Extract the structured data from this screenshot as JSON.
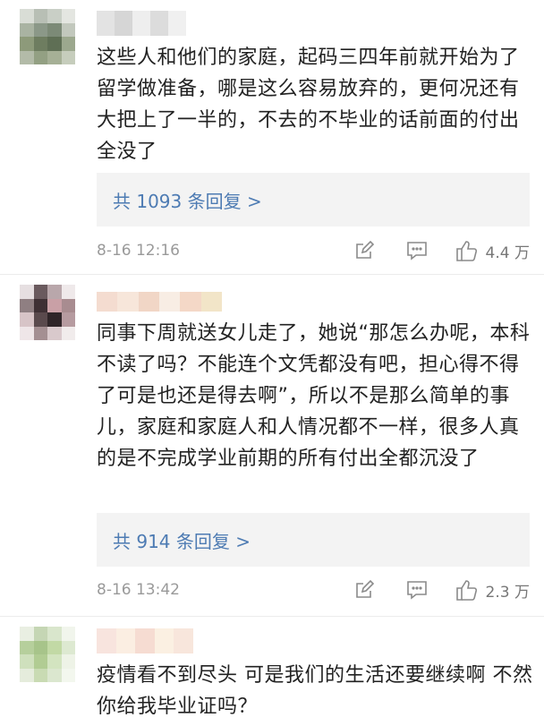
{
  "comments": [
    {
      "text": "这些人和他们的家庭，起码三四年前就开始为了留学做准备，哪是这么容易放弃的，更何况还有大把上了一半的，不去的不毕业的话前面的付出全没了",
      "reply_label": "共 1093 条回复 >",
      "timestamp": "8-16 12:16",
      "likes": "4.4 万",
      "avatar_colors": [
        "#d9ddd6",
        "#b8bfb5",
        "#c9cfc6",
        "#e4e6e1",
        "#a9b3a2",
        "#8b9888",
        "#7c8a77",
        "#c2c8bd",
        "#8d9a7a",
        "#6e7d60",
        "#5f6f55",
        "#9ca88e",
        "#b3bba8",
        "#93a083",
        "#a6b096",
        "#c6cdbc"
      ],
      "name_colors": [
        "#e3e3e3",
        "#d6d6d6",
        "#eeeeee",
        "#dcdcdc",
        "#f0f0f0"
      ]
    },
    {
      "text": "同事下周就送女儿走了，她说“那怎么办呢，本科不读了吗？不能连个文凭都没有吧，担心得不得了可是也还是得去啊”，所以不是那么简单的事儿，家庭和家庭人和人情况都不一样，很多人真的是不完成学业前期的所有付出全都沉没了",
      "reply_label": "共 914 条回复 >",
      "timestamp": "8-16 13:42",
      "likes": "2.3 万",
      "avatar_colors": [
        "#e6dfe1",
        "#6a5a5e",
        "#b9a7ab",
        "#efe9ea",
        "#8f7f82",
        "#3e3034",
        "#c9a0a6",
        "#a88c90",
        "#d7c4c7",
        "#5a4a4d",
        "#2f2528",
        "#b69ba0",
        "#efe6e8",
        "#a48f92",
        "#d9c9cc",
        "#f1ecec"
      ],
      "name_colors": [
        "#f4dcd0",
        "#f7e6da",
        "#f1d6c6",
        "#f8ede4",
        "#f4d8c7",
        "#f2e5c8"
      ]
    },
    {
      "text": "疫情看不到尽头 可是我们的生活还要继续啊 不然你给我毕业证吗？",
      "avatar_colors": [
        "#e9efe2",
        "#c5d6b4",
        "#d9e6cc",
        "#f1f5ec",
        "#b6cf9c",
        "#a7c48a",
        "#c2d9a5",
        "#dde9d1",
        "#cfe0bd",
        "#b1cc93",
        "#d3e4c0",
        "#eef3e7",
        "#e5ecdc",
        "#c9dbb3",
        "#dbe7cf",
        "#f3f7ee"
      ],
      "name_colors": [
        "#f8e4de",
        "#fbeee2",
        "#f6dcd2",
        "#fbf0e2",
        "#f8e6dc"
      ]
    }
  ],
  "icons": {
    "comment_icon": "pencil-square-icon",
    "reply_icon": "message-bubble-icon",
    "like_icon": "thumbs-up-icon"
  },
  "colors": {
    "link": "#4d7bb3",
    "meta_text": "#9a9a9a",
    "reply_bg": "#f3f3f3",
    "icon_stroke": "#8a8a8a"
  }
}
